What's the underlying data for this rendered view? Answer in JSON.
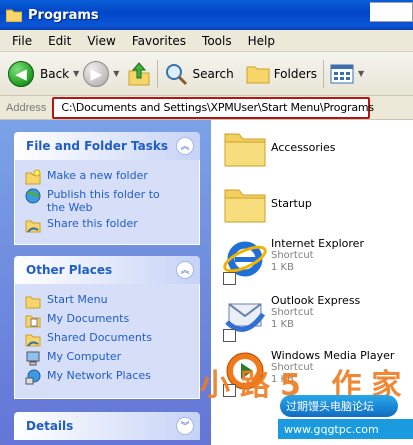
{
  "window": {
    "title": "Programs"
  },
  "menu": [
    "File",
    "Edit",
    "View",
    "Favorites",
    "Tools",
    "Help"
  ],
  "toolbar": {
    "back_label": "Back",
    "search_label": "Search",
    "folders_label": "Folders"
  },
  "address": {
    "label": "Address",
    "value": "C:\\Documents and Settings\\XPMUser\\Start Menu\\Programs"
  },
  "tasks_panel": {
    "title": "File and Folder Tasks",
    "items": [
      {
        "label": "Make a new folder",
        "icon": "new-folder-icon"
      },
      {
        "label": "Publish this folder to the Web",
        "icon": "globe-publish-icon"
      },
      {
        "label": "Share this folder",
        "icon": "share-folder-icon"
      }
    ]
  },
  "places_panel": {
    "title": "Other Places",
    "items": [
      {
        "label": "Start Menu",
        "icon": "folder-icon"
      },
      {
        "label": "My Documents",
        "icon": "my-documents-icon"
      },
      {
        "label": "Shared Documents",
        "icon": "shared-documents-icon"
      },
      {
        "label": "My Computer",
        "icon": "my-computer-icon"
      },
      {
        "label": "My Network Places",
        "icon": "network-places-icon"
      }
    ]
  },
  "details_panel": {
    "title": "Details"
  },
  "files": [
    {
      "name": "Accessories",
      "type": "folder"
    },
    {
      "name": "Startup",
      "type": "folder"
    },
    {
      "name": "Internet Explorer",
      "kind": "Shortcut",
      "size": "1 KB"
    },
    {
      "name": "Outlook Express",
      "kind": "Shortcut",
      "size": "1 KB"
    },
    {
      "name": "Windows Media Player",
      "kind": "Shortcut",
      "size": "1 KB"
    }
  ],
  "watermark": {
    "brand": "过期馒头电脑论坛",
    "url": "www.gqgtpc.com",
    "overlay": "小路5 作家"
  },
  "colors": {
    "title_bar": "#0046c7",
    "task_pane": "#7ba2e7",
    "link": "#215dc6",
    "highlight_box": "#b01818"
  }
}
